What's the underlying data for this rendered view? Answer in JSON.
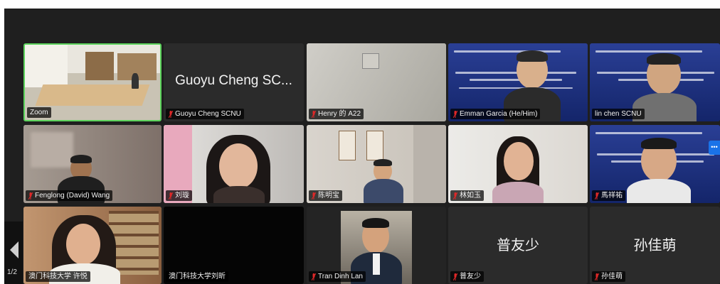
{
  "participants": [
    {
      "name": "Zoom"
    },
    {
      "name": "Guoyu Cheng SCNU",
      "display_text": "Guoyu Cheng SC..."
    },
    {
      "name": "Henry 的 A22"
    },
    {
      "name": "Emman Garcia (He/Him)"
    },
    {
      "name": "lin chen SCNU"
    },
    {
      "name": "Fenglong (David) Wang"
    },
    {
      "name": "刘璇"
    },
    {
      "name": "陈明宝"
    },
    {
      "name": "林如玉"
    },
    {
      "name": "馬祥祐"
    },
    {
      "name": "澳门科技大学 许悦"
    },
    {
      "name": "澳门科技大学刘昕"
    },
    {
      "name": "Tran Dinh Lan"
    },
    {
      "name": "普友少",
      "display_text": "普友少"
    },
    {
      "name": "孙佳萌",
      "display_text": "孙佳萌"
    }
  ],
  "pagination": {
    "label": "1/2"
  },
  "more_button": {
    "label": "•••"
  },
  "colors": {
    "meeting_bg": "#1f1f1f",
    "tile_bg": "#2b2b2b",
    "active_speaker_border": "#5bd35b",
    "muted_mic": "#e02828"
  },
  "icons": {
    "mic_muted": "muted-mic-icon",
    "prev_page": "chevron-left-icon",
    "more": "more-options-icon"
  }
}
